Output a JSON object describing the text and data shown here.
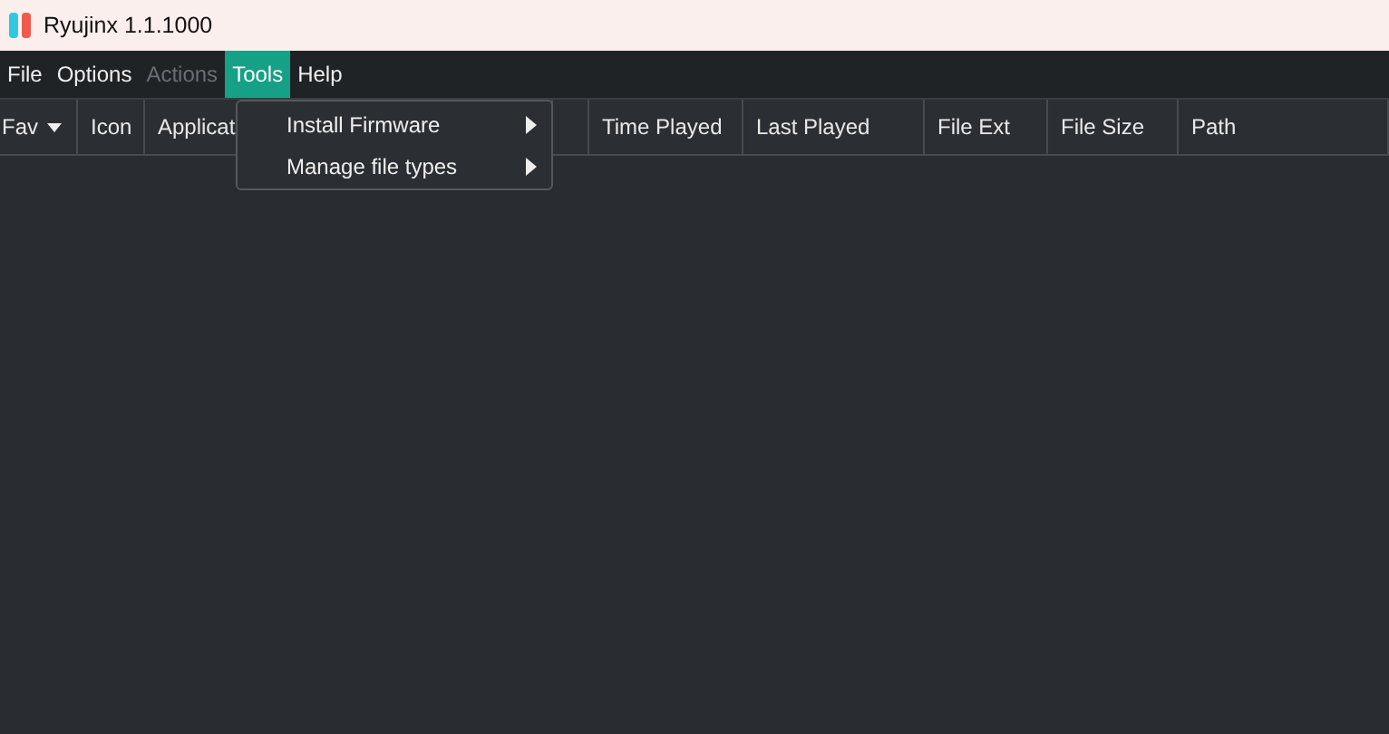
{
  "window": {
    "title": "Ryujinx 1.1.1000"
  },
  "menu_bar": [
    {
      "label": "File",
      "selected": false,
      "disabled": false
    },
    {
      "label": "Options",
      "selected": false,
      "disabled": false
    },
    {
      "label": "Actions",
      "selected": false,
      "disabled": true
    },
    {
      "label": "Tools",
      "selected": true,
      "disabled": false
    },
    {
      "label": "Help",
      "selected": false,
      "disabled": false
    }
  ],
  "tools_menu": [
    {
      "label": "Install Firmware",
      "submenu": true
    },
    {
      "label": "Manage file types",
      "submenu": true
    }
  ],
  "table": {
    "columns": [
      {
        "label": "Fav",
        "sorted": true
      },
      {
        "label": "Icon"
      },
      {
        "label": "Applicat"
      },
      {},
      {
        "label": "Time Played"
      },
      {
        "label": "Last Played"
      },
      {
        "label": "File Ext"
      },
      {
        "label": "File Size"
      },
      {
        "label": "Path"
      }
    ]
  }
}
